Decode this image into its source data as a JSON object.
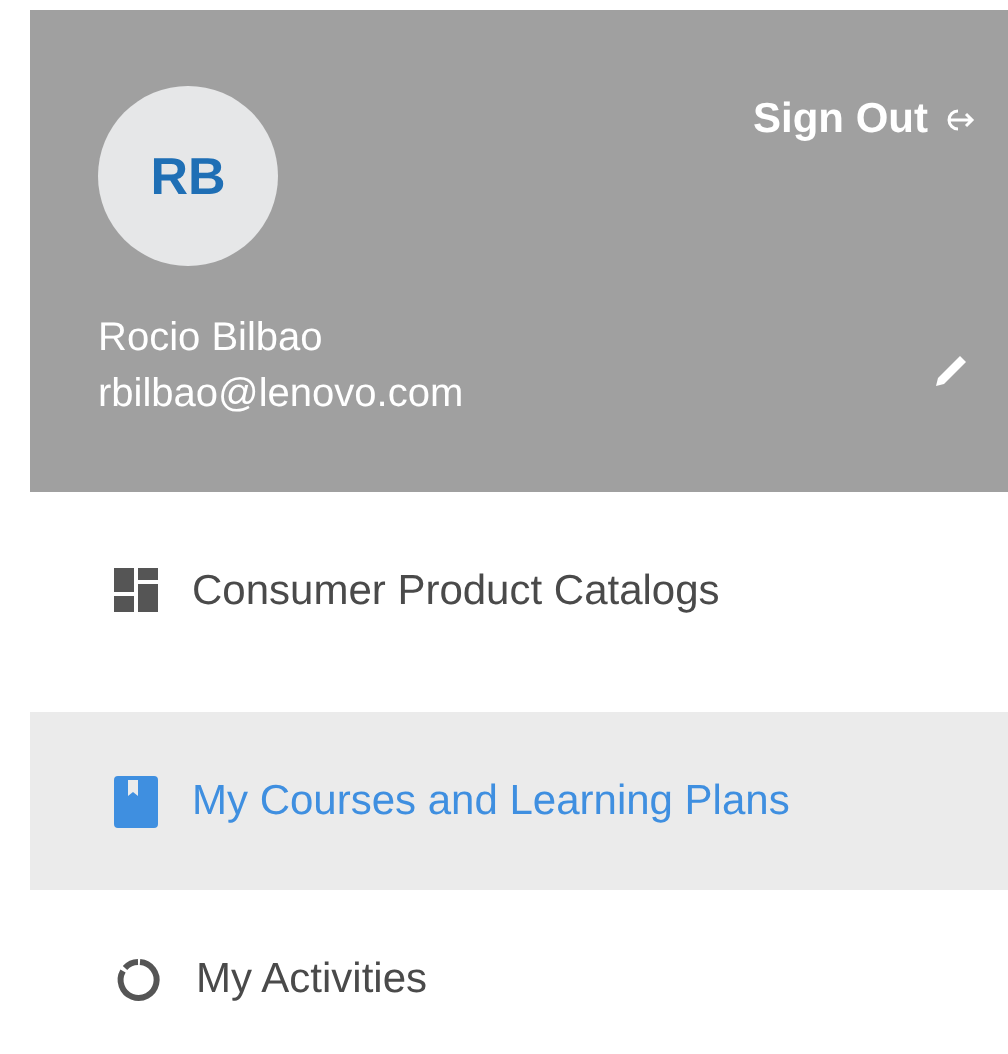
{
  "profile": {
    "initials": "RB",
    "name": "Rocio Bilbao",
    "email": "rbilbao@lenovo.com",
    "sign_out": "Sign Out"
  },
  "menu": [
    {
      "label": "Consumer Product Catalogs",
      "selected": false
    },
    {
      "label": "My Courses and Learning Plans",
      "selected": true
    },
    {
      "label": "My Activities",
      "selected": false
    }
  ]
}
